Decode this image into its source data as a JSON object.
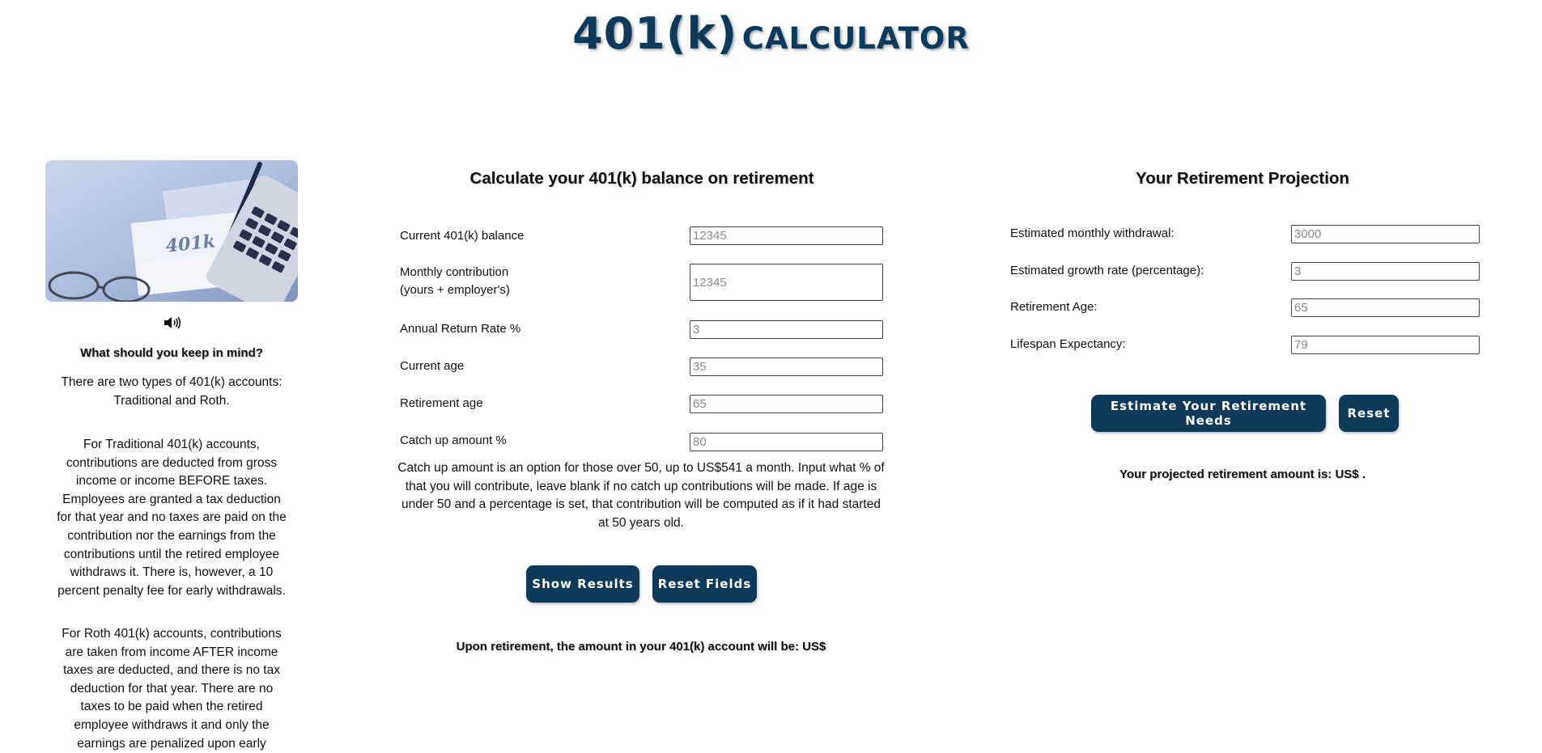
{
  "header": {
    "title_main": "401(k)",
    "title_sub": "CALCULATOR"
  },
  "left": {
    "image": "401k-calculator-photo",
    "speaker_icon": "speaker-icon",
    "heading": "What should you keep in mind?",
    "para1": "There are two types of 401(k) accounts: Traditional and Roth.",
    "para2": "For Traditional 401(k) accounts, contributions are deducted from gross income or income BEFORE taxes. Employees are granted a tax deduction for that year and no taxes are paid on the contribution nor the earnings from the contributions until the retired employee withdraws it. There is, however, a 10 percent penalty fee for early withdrawals.",
    "para3": "For Roth 401(k) accounts, contributions are taken from income AFTER income taxes are deducted, and there is no tax deduction for that year. There are no taxes to be paid when the retired employee withdraws it and only the earnings are penalized upon early"
  },
  "calculator": {
    "heading": "Calculate your 401(k) balance on retirement",
    "fields": [
      {
        "label": "Current 401(k) balance",
        "placeholder": "12345",
        "value": ""
      },
      {
        "label_line1": "Monthly contribution",
        "label_line2": "(yours + employer's)",
        "placeholder": "12345",
        "value": ""
      },
      {
        "label": "Annual Return Rate %",
        "placeholder": "3",
        "value": ""
      },
      {
        "label": "Current age",
        "placeholder": "35",
        "value": ""
      },
      {
        "label": "Retirement age",
        "placeholder": "65",
        "value": ""
      },
      {
        "label": "Catch up amount %",
        "placeholder": "80",
        "value": ""
      }
    ],
    "note": "Catch up amount is an option for those over 50, up to US$541 a month. Input what % of that you will contribute, leave blank if no catch up contributions will be made. If age is under 50 and a percentage is set, that contribution will be computed as if it had started at 50 years old.",
    "show_button": "Show Results",
    "reset_button": "Reset Fields",
    "result": "Upon retirement, the amount in your 401(k) account will be: US$"
  },
  "projection": {
    "heading": "Your Retirement Projection",
    "fields": [
      {
        "label": "Estimated monthly withdrawal:",
        "placeholder": "3000",
        "value": ""
      },
      {
        "label": "Estimated growth rate (percentage):",
        "placeholder": "3",
        "value": ""
      },
      {
        "label": "Retirement Age:",
        "placeholder": "65",
        "value": ""
      },
      {
        "label": "Lifespan Expectancy:",
        "placeholder": "79",
        "value": ""
      }
    ],
    "estimate_button": "Estimate Your Retirement Needs",
    "reset_button": "Reset",
    "result": "Your projected retirement amount is: US$ ."
  },
  "colors": {
    "brand": "#0d3a5a",
    "button_text": "#ffffff"
  }
}
